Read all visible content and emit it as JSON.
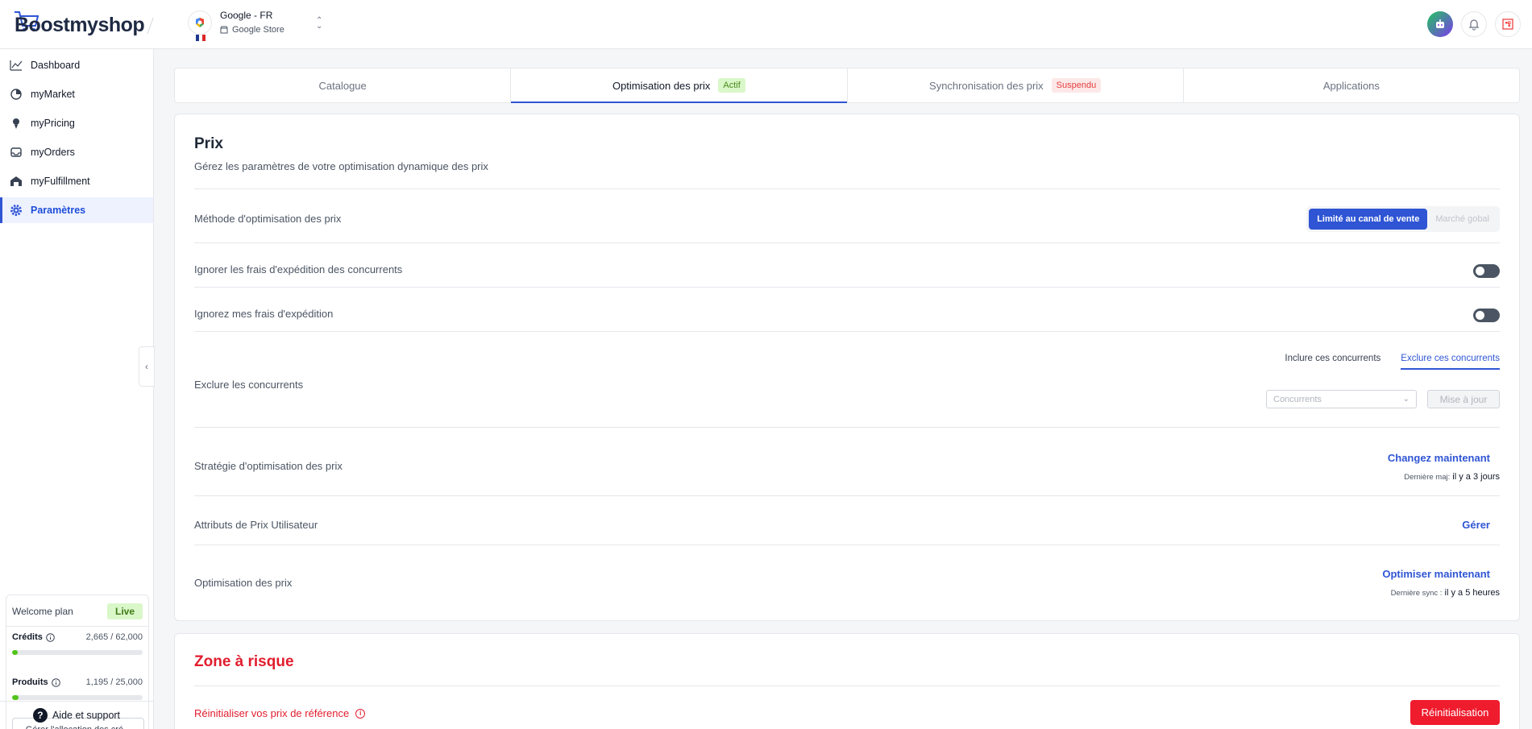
{
  "brand": {
    "logo_text": "Boostmyshop"
  },
  "store": {
    "name": "Google - FR",
    "sub": "Google Store"
  },
  "sidebar": {
    "items": [
      {
        "label": "Dashboard",
        "icon": "chart-line-icon"
      },
      {
        "label": "myMarket",
        "icon": "pie-chart-icon"
      },
      {
        "label": "myPricing",
        "icon": "pricing-pin-icon"
      },
      {
        "label": "myOrders",
        "icon": "inbox-icon"
      },
      {
        "label": "myFulfillment",
        "icon": "warehouse-icon"
      },
      {
        "label": "Paramètres",
        "icon": "gear-icon",
        "active": true
      }
    ],
    "plan": {
      "title": "Welcome plan",
      "status": "Live",
      "credits_label": "Crédits",
      "credits_value": "2,665 / 62,000",
      "credits_fraction": 0.043,
      "products_label": "Produits",
      "products_value": "1,195 / 25,000",
      "products_fraction": 0.048,
      "alloc_button": "Gérer l'allocation des cré..."
    },
    "help": "Aide et support"
  },
  "tabs": [
    {
      "label": "Catalogue",
      "badge": ""
    },
    {
      "label": "Optimisation des prix",
      "badge": "Actif",
      "active": true
    },
    {
      "label": "Synchronisation des prix",
      "badge": "Suspendu"
    },
    {
      "label": "Applications",
      "badge": ""
    }
  ],
  "prix": {
    "title": "Prix",
    "subtitle": "Gérez les paramètres de votre optimisation dynamique des prix",
    "method": {
      "label": "Méthode d'optimisation des prix",
      "option_active": "Limité au canal de vente",
      "option_inactive": "Marché gobal"
    },
    "ignore_competitors_shipping": "Ignorer les frais d'expédition des concurrents",
    "ignore_my_shipping": "Ignorez mes frais d'expédition",
    "exclude": {
      "label": "Exclure les concurrents",
      "tab_include": "Inclure ces concurrents",
      "tab_exclude": "Exclure ces concurrents",
      "select_placeholder": "Concurrents",
      "update_button": "Mise à jour"
    },
    "strategy": {
      "label": "Stratégie d'optimisation des prix",
      "link": "Changez maintenant",
      "meta_label": "Dernière maj:",
      "meta_value": "il y a 3 jours"
    },
    "user_attributes": {
      "label": "Attributs de Prix Utilisateur",
      "link": "Gérer"
    },
    "optimisation": {
      "label": "Optimisation des prix",
      "link": "Optimiser maintenant",
      "meta_label": "Dernière sync :",
      "meta_value": "il y a 5 heures"
    }
  },
  "danger": {
    "title": "Zone à risque",
    "reset_label": "Réinitialiser vos prix de référence",
    "reset_button": "Réinitialisation"
  },
  "colors": {
    "accent": "#2f55d4",
    "danger": "#ef1c2e",
    "live": "#d9f7c8"
  }
}
